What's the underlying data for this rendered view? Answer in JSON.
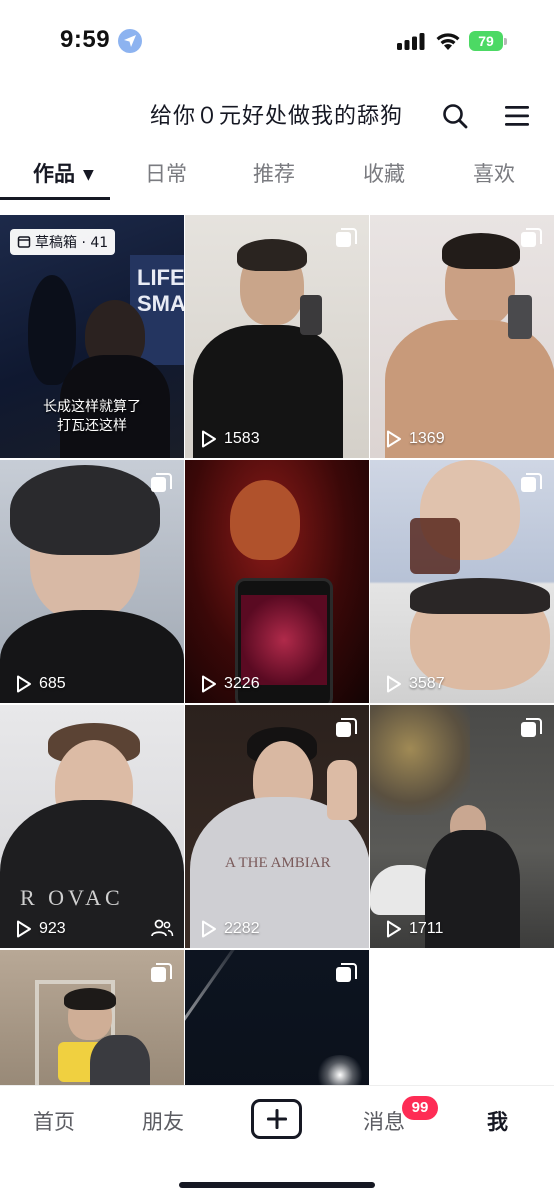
{
  "status_bar": {
    "time": "9:59",
    "battery_level": "79"
  },
  "header": {
    "title": "给你０元好处做我的舔狗"
  },
  "tabs": [
    {
      "label": "作品",
      "active": true
    },
    {
      "label": "日常",
      "active": false
    },
    {
      "label": "推荐",
      "active": false
    },
    {
      "label": "收藏",
      "active": false
    },
    {
      "label": "喜欢",
      "active": false
    }
  ],
  "grid": {
    "draft": {
      "badge": "草稿箱 · 41",
      "caption_line1": "长成这样就算了",
      "caption_line2": "打瓦还这样",
      "poster_text": "LIFE\nSMAI"
    },
    "videos": [
      {
        "plays": "1583"
      },
      {
        "plays": "1369"
      },
      {
        "plays": "685"
      },
      {
        "plays": "3226"
      },
      {
        "plays": "3587"
      },
      {
        "plays": "923"
      },
      {
        "plays": "2282"
      },
      {
        "plays": "1711"
      }
    ],
    "hoodie_text": "A THE AMBIAR"
  },
  "bottom_nav": {
    "home": "首页",
    "friends": "朋友",
    "messages": "消息",
    "messages_badge": "99",
    "me": "我"
  },
  "colors": {
    "accent": "#fe2c55",
    "text": "#161823",
    "battery": "#4cd964"
  }
}
